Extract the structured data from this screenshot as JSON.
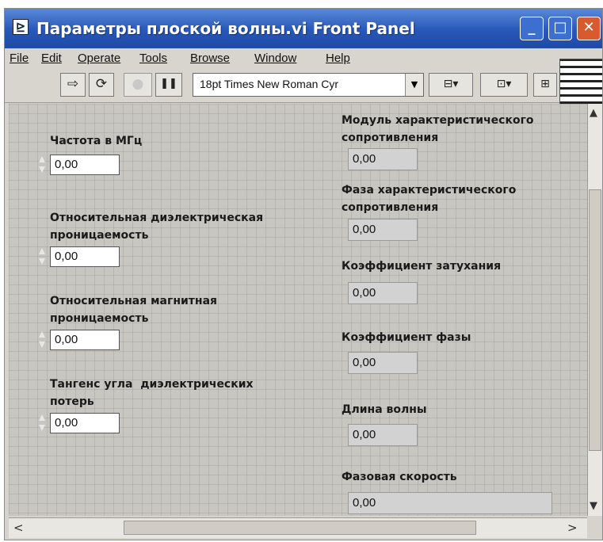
{
  "window": {
    "title": "Параметры плоской волны.vi Front Panel",
    "title_icon": "⊵",
    "minimize": "_",
    "maximize": "□",
    "close": "✕"
  },
  "menu": [
    "File",
    "Edit",
    "Operate",
    "Tools",
    "Browse",
    "Window",
    "Help"
  ],
  "toolbar": {
    "run_icon": "⇨",
    "run_continuous_icon": "⟳",
    "abort_icon": "●",
    "pause_icon": "❚❚",
    "font": "18pt Times New Roman Cyr",
    "dropdown_arrow": "▼",
    "align_icon": "⊟▾",
    "distribute_icon": "⊡▾",
    "resize_icon": "⊞"
  },
  "controls": [
    {
      "label": "Частота в МГц",
      "value": "0,00"
    },
    {
      "label": "Относительная диэлектрическая проницаемость",
      "value": "0,00"
    },
    {
      "label": "Относительная магнитная проницаемость",
      "value": "0,00"
    },
    {
      "label": "Тангенс угла  диэлектрических потерь",
      "value": "0,00"
    }
  ],
  "indicators": [
    {
      "label": "Модуль характеристического сопротивления",
      "value": "0,00"
    },
    {
      "label": "Фаза характеристического сопротивления",
      "value": "0,00"
    },
    {
      "label": "Коэффициент затухания",
      "value": "0,00"
    },
    {
      "label": "Коэффициент фазы",
      "value": "0,00"
    },
    {
      "label": "Длина волны",
      "value": "0,00"
    },
    {
      "label": "Фазовая скорость",
      "value": "0,00"
    }
  ],
  "scrollbars": {
    "up": "▲",
    "down": "▼",
    "left": "<",
    "right": ">"
  },
  "colors": {
    "title_bar": "#2757b8",
    "panel_bg": "#c8c6c1",
    "close_button": "#d85a2f"
  }
}
